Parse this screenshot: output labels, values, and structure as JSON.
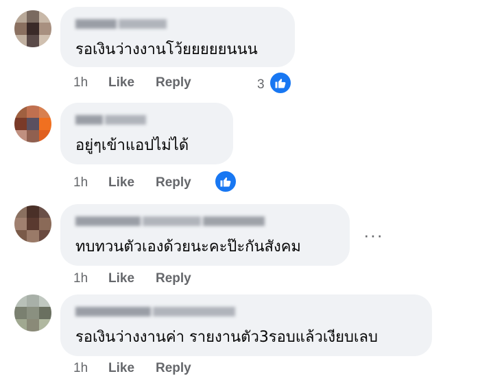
{
  "comments": [
    {
      "text": "รอเงินว่างงานโว้ยยยยยนนน",
      "time": "1h",
      "like": "Like",
      "reply": "Reply",
      "reactions": "3"
    },
    {
      "text": "อยู่ๆเข้าแอปไม่ได้",
      "time": "1h",
      "like": "Like",
      "reply": "Reply",
      "reactions": ""
    },
    {
      "text": "ทบทวนตัวเองด้วยนะคะป๊ะกันสังคม",
      "time": "1h",
      "like": "Like",
      "reply": "Reply",
      "more": "···"
    },
    {
      "text": "รอเงินว่างงานค่า รายงานตัว3รอบแล้วเงียบเลบ",
      "time": "1h",
      "like": "Like",
      "reply": "Reply"
    }
  ],
  "icons": {
    "like_reaction": "thumbs-up-icon",
    "more": "more-options-icon"
  },
  "colors": {
    "bubble": "#f0f2f5",
    "secondary_text": "#65676b",
    "reaction_blue": "#1877f2"
  }
}
